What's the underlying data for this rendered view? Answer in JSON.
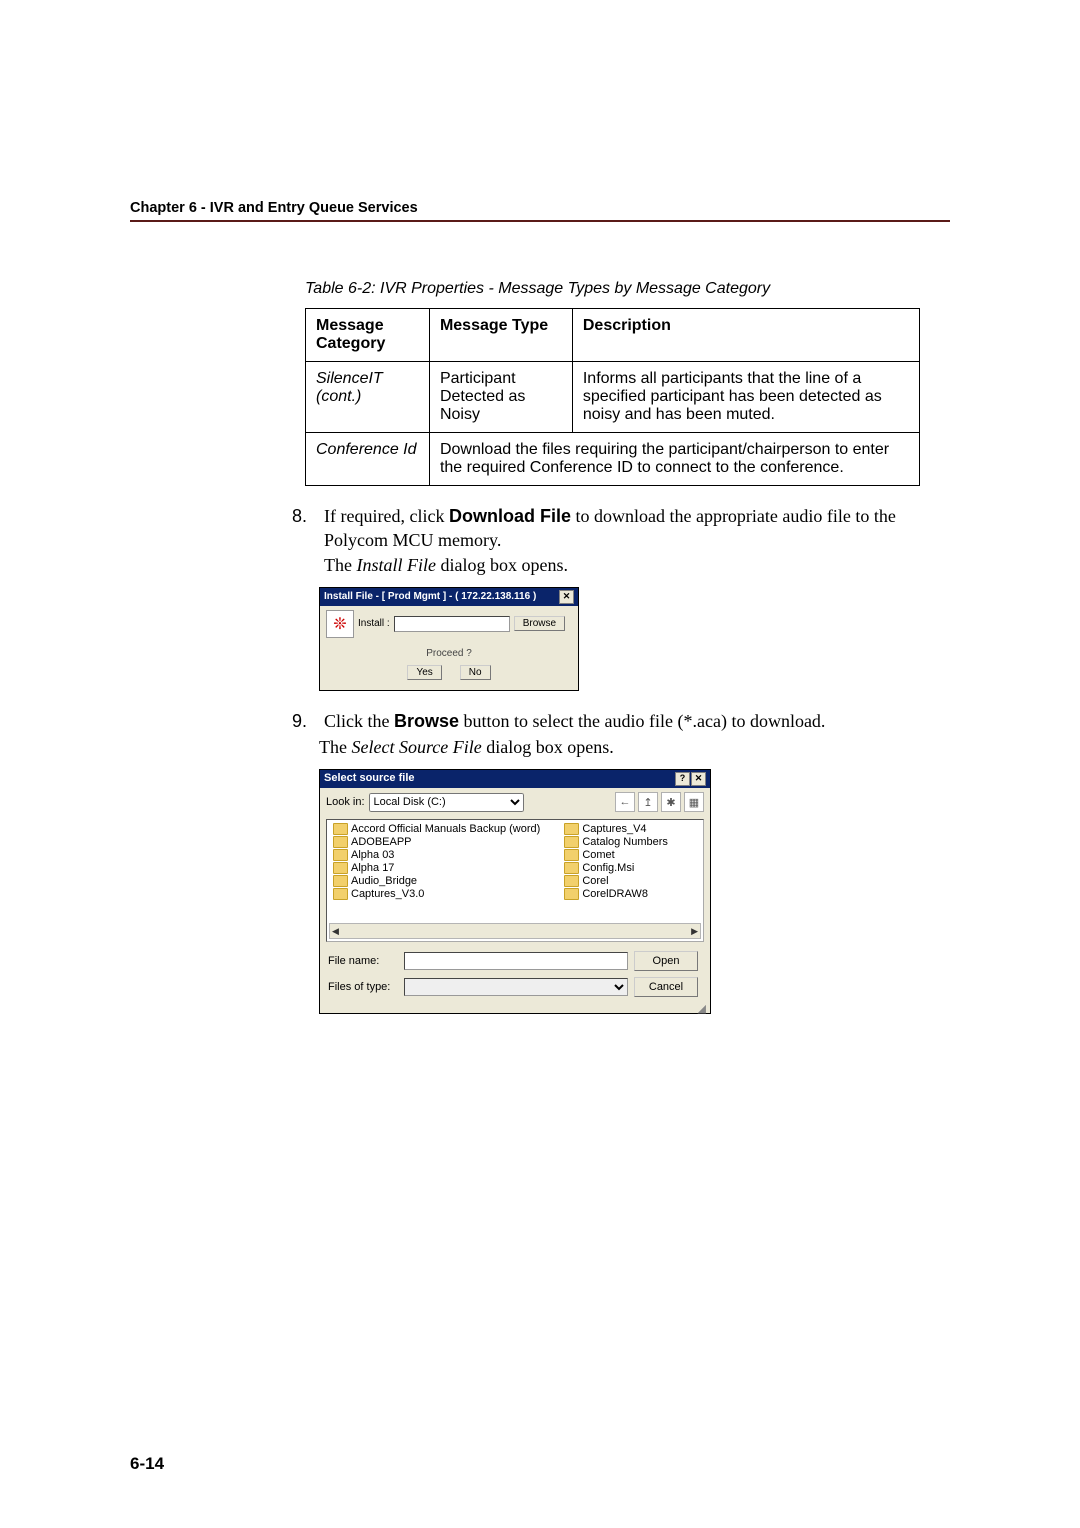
{
  "header": {
    "chapter": "Chapter 6 - IVR and Entry Queue Services"
  },
  "table": {
    "caption": "Table 6-2: IVR Properties - Message Types by Message Category",
    "headers": {
      "col1": "Message Category",
      "col2": "Message Type",
      "col3": "Description"
    },
    "rows": [
      {
        "category": "SilenceIT (cont.)",
        "type": "Participant Detected as Noisy",
        "desc": "Informs all participants that the line of a specified participant has been detected as noisy and has been muted."
      },
      {
        "category": "Conference Id",
        "merged_desc": "Download the files requiring the participant/chairperson to enter the required Conference ID to connect to the conference."
      }
    ]
  },
  "steps": {
    "s8": {
      "num": "8.",
      "text_pre": "If required, click ",
      "bold": "Download File",
      "text_post": " to download the appropriate audio file to the Polycom MCU memory.",
      "follow": "The Install File dialog box opens."
    },
    "s9": {
      "num": "9.",
      "text_pre": "Click the ",
      "bold": "Browse",
      "text_post": " button to select the audio file (*.aca) to download.",
      "follow": "The Select Source File dialog box opens."
    }
  },
  "dialog1": {
    "title": "Install File - [ Prod Mgmt ] - ( 172.22.138.116 )",
    "install_label": "Install :",
    "install_value": "",
    "browse": "Browse",
    "proceed": "Proceed ?",
    "yes": "Yes",
    "no": "No"
  },
  "dialog2": {
    "title": "Select source file",
    "lookin_label": "Look in:",
    "lookin_value": "Local Disk (C:)",
    "icons": [
      "←",
      "↥",
      "✱",
      "▦"
    ],
    "folders_col1": [
      "Accord Official Manuals Backup (word)",
      "ADOBEAPP",
      "Alpha 03",
      "Alpha 17",
      "Audio_Bridge",
      "Captures_V3.0"
    ],
    "folders_col2": [
      "Captures_V4",
      "Catalog Numbers",
      "Comet",
      "Config.Msi",
      "Corel",
      "CorelDRAW8"
    ],
    "scroll_left": "◀",
    "scroll_right": "▶",
    "filename_label": "File name:",
    "filename_value": "",
    "filetype_label": "Files of type:",
    "filetype_value": "",
    "open": "Open",
    "cancel": "Cancel"
  },
  "page_number": "6-14"
}
